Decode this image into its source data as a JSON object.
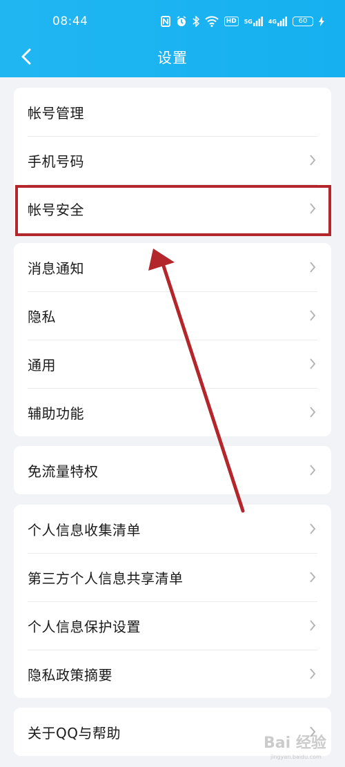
{
  "status_bar": {
    "time": "08:44",
    "hd_label": "HD",
    "signal1_label": "5G",
    "signal2_label": "4G",
    "battery_level": "60"
  },
  "nav": {
    "title": "设置"
  },
  "groups": [
    {
      "items": [
        "帐号管理",
        "手机号码",
        "帐号安全"
      ]
    },
    {
      "items": [
        "消息通知",
        "隐私",
        "通用",
        "辅助功能"
      ]
    },
    {
      "items": [
        "免流量特权"
      ]
    },
    {
      "items": [
        "个人信息收集清单",
        "第三方个人信息共享清单",
        "个人信息保护设置",
        "隐私政策摘要"
      ]
    },
    {
      "items": [
        "关于QQ与帮助"
      ]
    }
  ],
  "annotation": {
    "highlight_color": "#b3262b"
  },
  "watermark": {
    "text": "Bai 经验",
    "sub": "jingyan.baidu.com"
  },
  "colors": {
    "header": "#18b2f1",
    "background": "#f2f3f7"
  }
}
